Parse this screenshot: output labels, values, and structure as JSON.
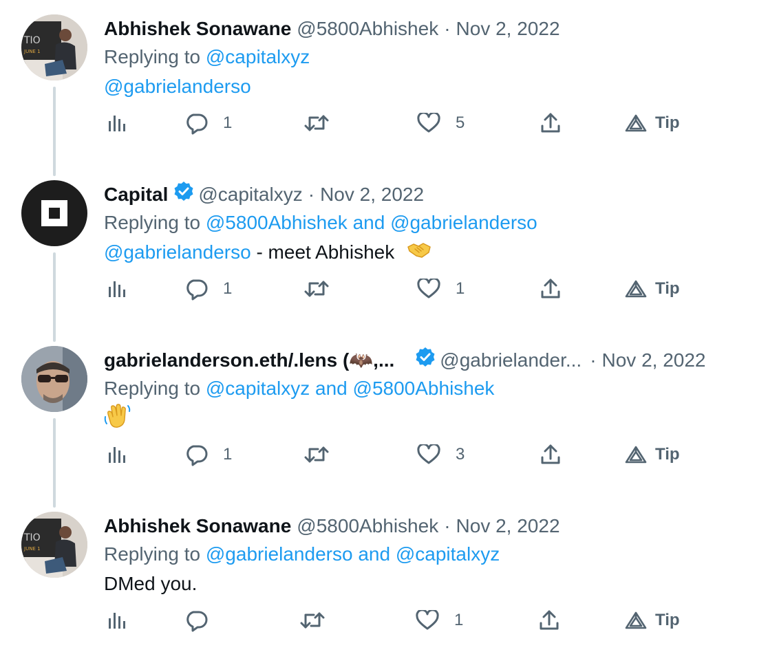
{
  "tweets": [
    {
      "name": "Abhishek Sonawane",
      "handle": "@5800Abhishek",
      "separator": "·",
      "date": "Nov 2, 2022",
      "replying_prefix": "Replying to",
      "replying_to": [
        "@capitalxyz"
      ],
      "replying_joiner": "",
      "body_mention": "@gabrielanderso",
      "body_text": "",
      "actions": {
        "analytics": "",
        "replies": "1",
        "retweets": "",
        "likes": "5",
        "share": "",
        "tip": "Tip"
      }
    },
    {
      "name": "Capital",
      "verified": true,
      "handle": "@capitalxyz",
      "separator": "·",
      "date": "Nov 2, 2022",
      "replying_prefix": "Replying to",
      "replying_to": [
        "@5800Abhishek",
        "@gabrielanderso"
      ],
      "replying_joiner": "and",
      "body_mention": "@gabrielanderso",
      "body_text": " - meet Abhishek",
      "body_emoji": "handshake",
      "actions": {
        "analytics": "",
        "replies": "1",
        "retweets": "",
        "likes": "1",
        "share": "",
        "tip": "Tip"
      }
    },
    {
      "name": "gabrielanderson.eth/.lens (🦇,...",
      "verified": true,
      "handle": "@gabrielander...",
      "separator": "·",
      "date": "Nov 2, 2022",
      "replying_prefix": "Replying to",
      "replying_to": [
        "@capitalxyz",
        "@5800Abhishek"
      ],
      "replying_joiner": "and",
      "body_emoji": "waving-hand",
      "actions": {
        "analytics": "",
        "replies": "1",
        "retweets": "",
        "likes": "3",
        "share": "",
        "tip": "Tip"
      }
    },
    {
      "name": "Abhishek Sonawane",
      "handle": "@5800Abhishek",
      "separator": "·",
      "date": "Nov 2, 2022",
      "replying_prefix": "Replying to",
      "replying_to": [
        "@gabrielanderso",
        "@capitalxyz"
      ],
      "replying_joiner": "and",
      "body_text": "DMed you.",
      "actions": {
        "analytics": "",
        "replies": "",
        "retweets": "",
        "likes": "1",
        "share": "",
        "tip": "Tip"
      }
    }
  ],
  "colors": {
    "link": "#1d9bf0",
    "muted": "#536471",
    "text": "#0f1419",
    "verified": "#1d9bf0",
    "thread_line": "#cfd9de"
  },
  "icons": [
    "analytics-icon",
    "reply-icon",
    "retweet-icon",
    "like-icon",
    "share-icon",
    "tip-icon",
    "verified-badge-icon",
    "handshake-icon",
    "waving-hand-icon"
  ]
}
